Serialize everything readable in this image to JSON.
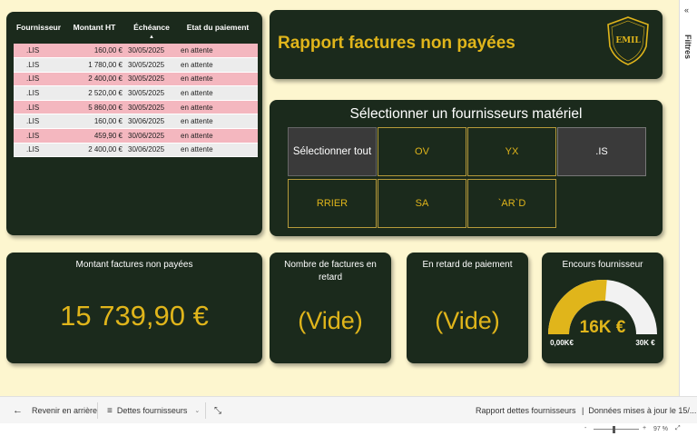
{
  "table": {
    "headers": [
      "Fournisseur",
      "Montant HT",
      "Échéance",
      "Etat du paiement"
    ],
    "rows": [
      {
        "fournisseur": ".LIS",
        "montant": "160,00 €",
        "echeance": "30/05/2025",
        "etat": "en attente"
      },
      {
        "fournisseur": ".LIS",
        "montant": "1 780,00 €",
        "echeance": "30/05/2025",
        "etat": "en attente"
      },
      {
        "fournisseur": ".LIS",
        "montant": "2 400,00 €",
        "echeance": "30/05/2025",
        "etat": "en attente"
      },
      {
        "fournisseur": ".LIS",
        "montant": "2 520,00 €",
        "echeance": "30/05/2025",
        "etat": "en attente"
      },
      {
        "fournisseur": ".LIS",
        "montant": "5 860,00 €",
        "echeance": "30/05/2025",
        "etat": "en attente"
      },
      {
        "fournisseur": ".LIS",
        "montant": "160,00 €",
        "echeance": "30/06/2025",
        "etat": "en attente"
      },
      {
        "fournisseur": ".LIS",
        "montant": "459,90 €",
        "echeance": "30/06/2025",
        "etat": "en attente"
      },
      {
        "fournisseur": ".LIS",
        "montant": "2 400,00 €",
        "echeance": "30/06/2025",
        "etat": "en attente"
      }
    ]
  },
  "header": {
    "title": "Rapport factures non payées",
    "logo_text": "EMIL"
  },
  "slicer": {
    "title": "Sélectionner un fournisseurs matériel",
    "select_all": "Sélectionner tout",
    "options": [
      "OV",
      "YX",
      ".IS",
      "RRIER",
      "SA",
      "`AR`D"
    ],
    "selected": ".IS"
  },
  "kpis": {
    "montant_label": "Montant factures non payées",
    "montant_value": "15 739,90 €",
    "retard_label": "Nombre de factures en retard",
    "retard_value": "(Vide)",
    "retard_paiement_label": "En retard de paiement",
    "retard_paiement_value": "(Vide)",
    "encours_label": "Encours fournisseur",
    "encours_value": "16K €",
    "encours_min": "0,00K€",
    "encours_max": "30K €",
    "encours_fraction": 0.525
  },
  "filters": {
    "label": "Filtres",
    "collapse_icon": "double-chevron-right-icon"
  },
  "bottom_bar": {
    "back_label": "Revenir en arrière",
    "page_label": "Dettes fournisseurs",
    "report_name": "Rapport dettes fournisseurs",
    "data_updated": "Données mises à jour le 15/..."
  },
  "status_bar": {
    "zoom": "97 %"
  },
  "colors": {
    "accent": "#e0b51b",
    "card_bg": "#1b2a1c",
    "canvas_bg": "#fdf6cf",
    "row_pink": "#f4b7bf",
    "row_grey": "#ececec",
    "gauge_track": "#f2f2f2"
  }
}
